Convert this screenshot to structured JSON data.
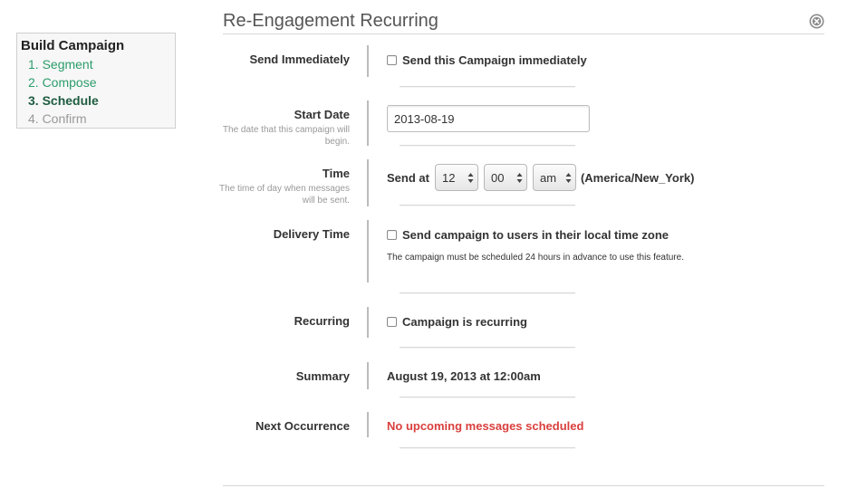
{
  "sidebar": {
    "title": "Build Campaign",
    "steps": [
      {
        "label": "1. Segment",
        "state": "done"
      },
      {
        "label": "2. Compose",
        "state": "done"
      },
      {
        "label": "3. Schedule",
        "state": "active"
      },
      {
        "label": "4. Confirm",
        "state": "todo"
      }
    ]
  },
  "header": {
    "title": "Re-Engagement Recurring",
    "close_icon": "close-circle-icon"
  },
  "form": {
    "send_immediately": {
      "label": "Send Immediately",
      "checkbox_label": "Send this Campaign immediately",
      "checked": false
    },
    "start_date": {
      "label": "Start Date",
      "help": "The date that this campaign will begin.",
      "value": "2013-08-19"
    },
    "time": {
      "label": "Time",
      "help": "The time of day when messages will be sent.",
      "prefix": "Send at",
      "hour": "12",
      "minute": "00",
      "ampm": "am",
      "timezone": "(America/New_York)"
    },
    "delivery_time": {
      "label": "Delivery Time",
      "checkbox_label": "Send campaign to users in their local time zone",
      "checked": false,
      "note": "The campaign must be scheduled 24 hours in advance to use this feature."
    },
    "recurring": {
      "label": "Recurring",
      "checkbox_label": "Campaign is recurring",
      "checked": false
    },
    "summary": {
      "label": "Summary",
      "value": "August 19, 2013 at 12:00am"
    },
    "next_occurrence": {
      "label": "Next Occurrence",
      "value": "No upcoming messages scheduled"
    }
  },
  "colors": {
    "step_done": "#2c9d6b",
    "step_active": "#1f5c40",
    "warning": "#d9403d"
  }
}
